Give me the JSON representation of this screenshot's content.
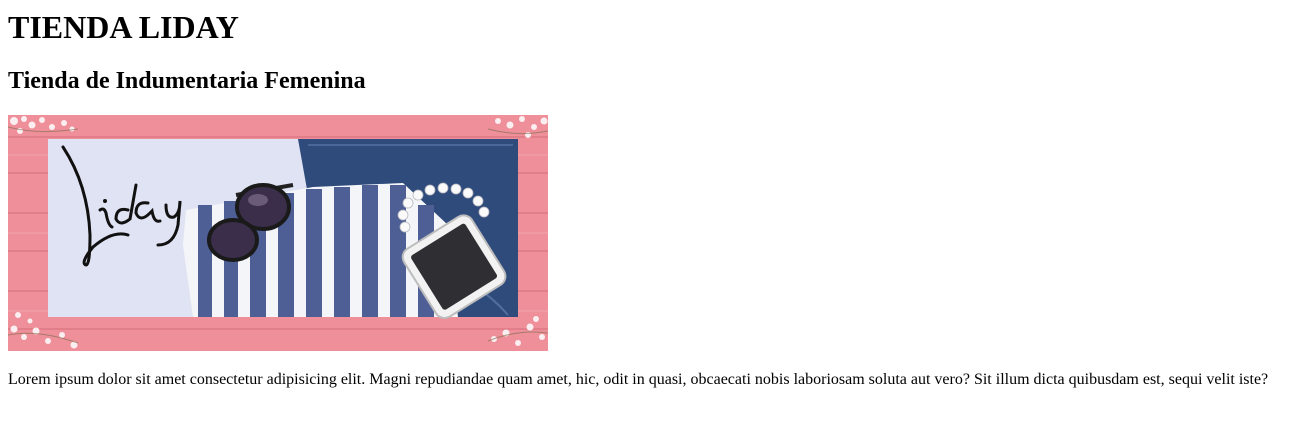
{
  "page": {
    "title": "TIENDA LIDAY",
    "subtitle": "Tienda de Indumentaria Femenina",
    "banner": {
      "logo_text": "Liday",
      "colors": {
        "wood": "#ee8f9a",
        "wood_dark": "#e07a87",
        "panel": "#dfe3f3",
        "denim": "#2f4b7c",
        "stripe_blue": "#4e5f95",
        "stripe_white": "#f4f5f8"
      }
    },
    "paragraph": "Lorem ipsum dolor sit amet consectetur adipisicing elit. Magni repudiandae quam amet, hic, odit in quasi, obcaecati nobis laboriosam soluta aut vero? Sit illum dicta quibusdam est, sequi velit iste?"
  }
}
